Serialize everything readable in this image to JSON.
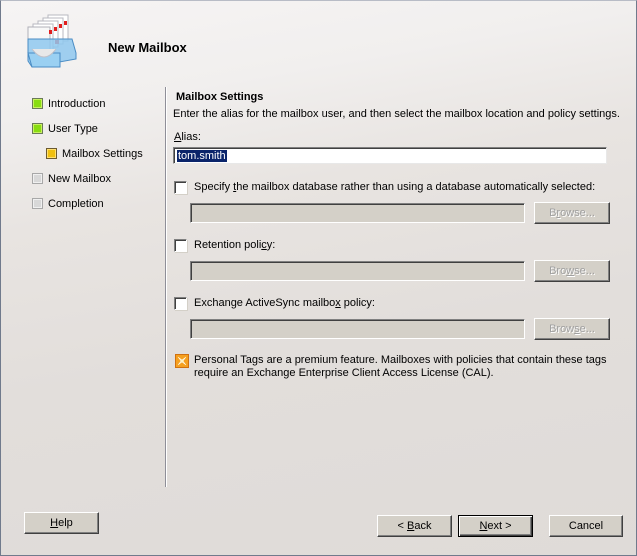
{
  "wizard": {
    "title": "New Mailbox",
    "header_icon": "mailbox-tray-icon"
  },
  "nav": {
    "items": [
      {
        "label": "Introduction",
        "state": "done"
      },
      {
        "label": "User Type",
        "state": "done"
      },
      {
        "label": "Mailbox Settings",
        "state": "current"
      },
      {
        "label": "New Mailbox",
        "state": "pending"
      },
      {
        "label": "Completion",
        "state": "pending"
      }
    ],
    "state_colors": {
      "done": "#88dd10",
      "current": "#f0c010",
      "pending": "#d8d8d8"
    }
  },
  "main": {
    "section_title": "Mailbox Settings",
    "description": "Enter the alias for the mailbox user, and then select the mailbox location and policy settings.",
    "alias": {
      "label_accel": "A",
      "label_rest": "lias:",
      "value": "tom.smith"
    },
    "options": [
      {
        "label_pre": "Specify ",
        "label_accel": "t",
        "label_post": "he mailbox database rather than using a database automatically selected:",
        "checked": false,
        "value": "",
        "browse": {
          "pre": "B",
          "accel": "r",
          "post": "owse..."
        }
      },
      {
        "label_pre": "Retention poli",
        "label_accel": "c",
        "label_post": "y:",
        "checked": false,
        "value": "",
        "browse": {
          "pre": "Bro",
          "accel": "w",
          "post": "se..."
        }
      },
      {
        "label_pre": "Exchange ActiveSync mailbo",
        "label_accel": "x",
        "label_post": " policy:",
        "checked": false,
        "value": "",
        "browse": {
          "pre": "Brow",
          "accel": "s",
          "post": "e..."
        }
      }
    ],
    "info": {
      "icon": "exchange-info-icon",
      "line1": "Personal Tags are a premium feature. Mailboxes with policies that contain these tags",
      "line2": "require an Exchange Enterprise Client Access License (CAL)."
    }
  },
  "footer": {
    "help": {
      "accel": "H",
      "rest": "elp"
    },
    "back": {
      "pre": "< ",
      "accel": "B",
      "rest": "ack"
    },
    "next": {
      "accel": "N",
      "rest": "ext >"
    },
    "cancel": "Cancel"
  },
  "colors": {
    "selection": "#0a246a",
    "button_face": "#d4d0c8",
    "info_icon": "#f09020"
  }
}
